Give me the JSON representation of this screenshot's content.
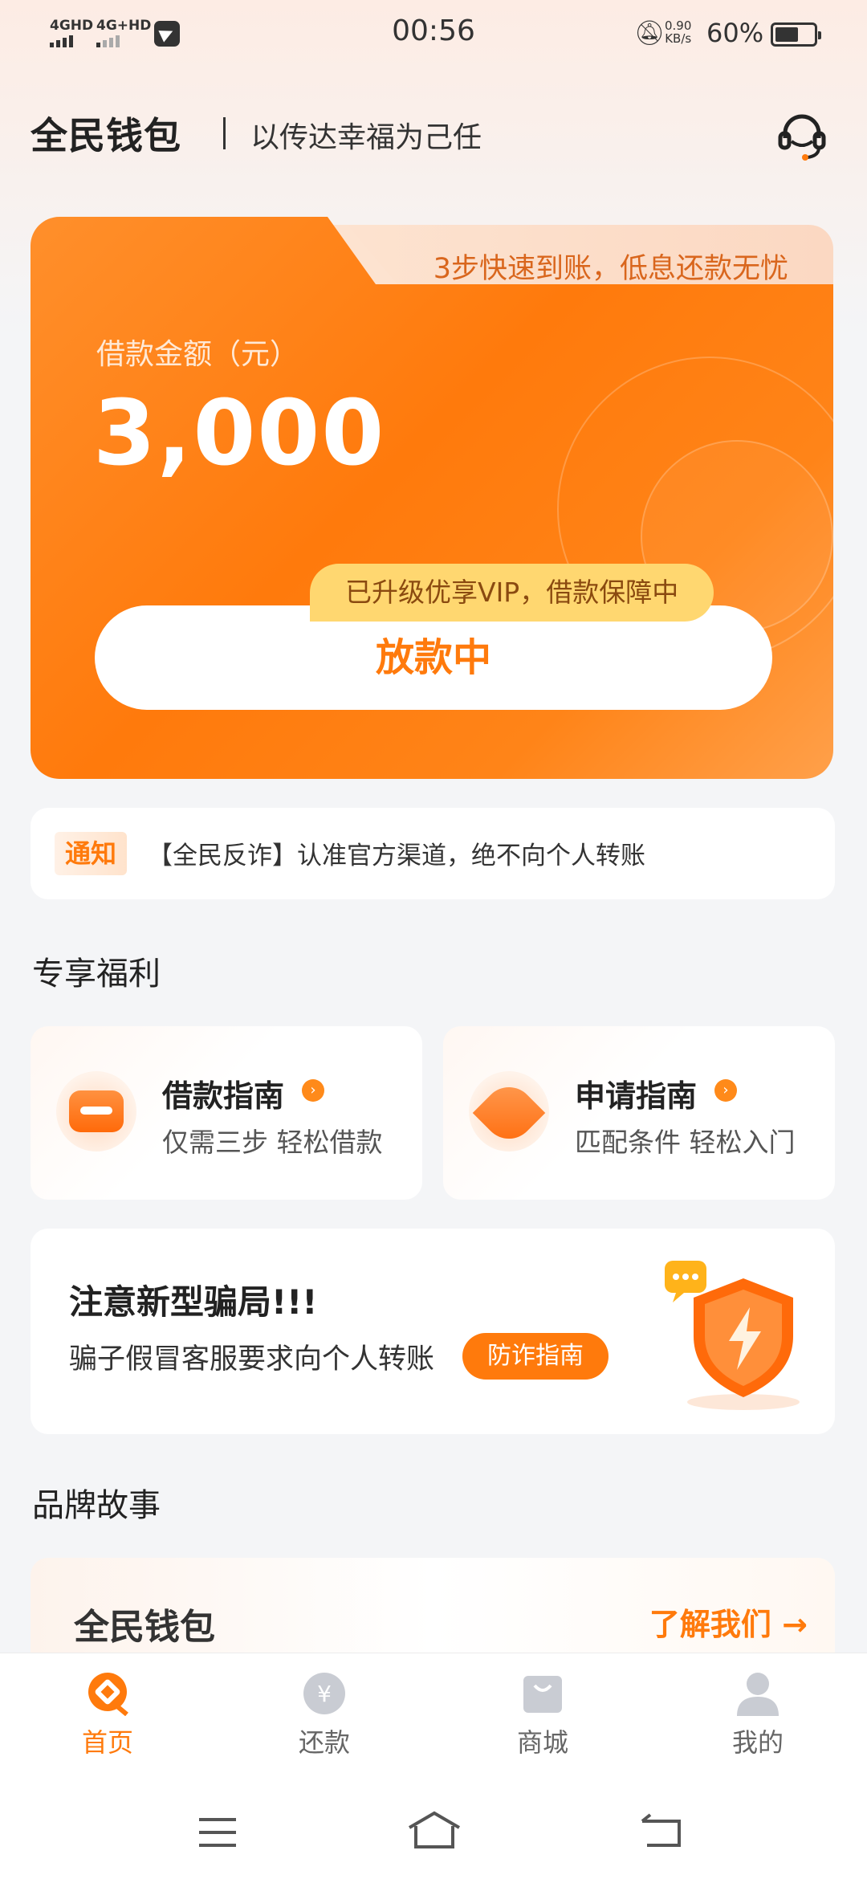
{
  "status_bar": {
    "signal1": "4GHD",
    "signal2": "4G+HD",
    "time": "00:56",
    "net_speed_value": "0.90",
    "net_speed_unit": "KB/s",
    "battery": "60%",
    "battery_level": 0.6
  },
  "header": {
    "brand": "全民钱包",
    "slogan": "以传达幸福为己任",
    "service_icon": "customer-service-headset-icon"
  },
  "hero": {
    "tab_text": "3步快速到账，低息还款无忧",
    "amount_label": "借款金额（元）",
    "amount": "3,000",
    "vip_badge": "已升级优享VIP，借款保障中",
    "status_button": "放款中"
  },
  "notice": {
    "tag": "通知",
    "text": "【全民反诈】认准官方渠道，绝不向个人转账"
  },
  "benefits": {
    "title": "专享福利",
    "items": [
      {
        "title": "借款指南",
        "subtitle": "仅需三步 轻松借款",
        "icon": "loan-guide-icon"
      },
      {
        "title": "申请指南",
        "subtitle": "匹配条件 轻松入门",
        "icon": "compass-icon"
      }
    ]
  },
  "fraud": {
    "title": "注意新型骗局!!!",
    "subtitle": "骗子假冒客服要求向个人转账",
    "button": "防诈指南",
    "icon": "shield-lightning-icon"
  },
  "brand_story": {
    "title": "品牌故事",
    "card_title": "全民钱包",
    "link": "了解我们 →"
  },
  "bottom_nav": [
    {
      "label": "首页",
      "icon": "home-icon",
      "active": true
    },
    {
      "label": "还款",
      "icon": "yen-icon",
      "active": false
    },
    {
      "label": "商城",
      "icon": "shopping-bag-icon",
      "active": false
    },
    {
      "label": "我的",
      "icon": "user-icon",
      "active": false
    }
  ],
  "colors": {
    "accent": "#ff7a0c",
    "vip": "#ffd770",
    "background": "#f4f5f7"
  }
}
